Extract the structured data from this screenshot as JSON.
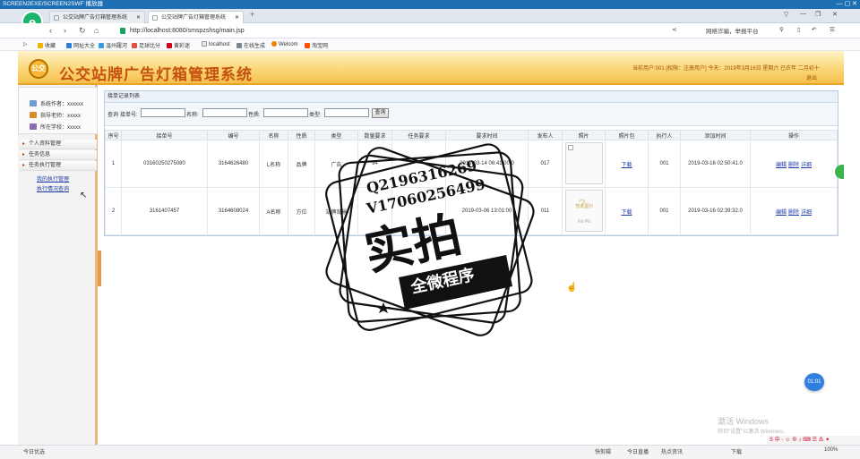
{
  "window": {
    "title": "SCREEN2EXE/SCREEN2SWF 播放器",
    "controls": "— ▢ ✕"
  },
  "tabs": [
    {
      "label": "公交站牌广告灯箱管理系统",
      "active": false
    },
    {
      "label": "公交站牌广告灯箱管理系统",
      "active": true
    }
  ],
  "newtab": "+",
  "address": {
    "url": "http://localhost:8080/smspzshsg/main.jsp",
    "right_text": "网络诈骗，举报平台"
  },
  "bookmarks": [
    "收藏",
    "网址大全",
    "温州履河",
    "足球比分",
    "黄彩迷",
    "localhost",
    "在线生成",
    "Welcom",
    "淘宝网"
  ],
  "header": {
    "logo": "公交",
    "title": "公交站牌广告灯箱管理系统",
    "info": "当前用户:001 [权限：注册用户] 今天：2019年3月16日 星期六 已农年 二月初十",
    "exit": "退出"
  },
  "sidebar": {
    "info": [
      {
        "label": "系统作者：xxxxxx"
      },
      {
        "label": "指导老师：xxxxx"
      },
      {
        "label": "所在学校：xxxxx"
      }
    ],
    "menus": [
      "个人资料管理",
      "任务信息",
      "任务执行管理"
    ],
    "submenus": [
      "我的执行管理",
      "执行情况查询"
    ]
  },
  "panel": {
    "title": "接单记录列表",
    "search": {
      "lead": "查询",
      "fields": [
        "接单号:",
        "名称:",
        "性质:",
        "类型:"
      ],
      "button": "查询"
    },
    "columns": [
      "序号",
      "接单号",
      "编号",
      "名称",
      "性质",
      "类型",
      "数量要求",
      "任务要求",
      "要求时间",
      "发布人",
      "照片",
      "照片包",
      "执行人",
      "添加时间",
      "操作"
    ],
    "rows": [
      {
        "idx": "1",
        "order": "03160250275080",
        "code": "3164626480",
        "name": "L名称",
        "nature": "品牌",
        "type": "广告",
        "qty": "94",
        "req": "",
        "time": "2019-03-14 06:41:00.0",
        "publisher": "017",
        "photo": "",
        "pkg": "下载",
        "executor": "001",
        "added": "2019-03-16 02:50:41.0",
        "ops": [
          "编辑",
          "删除",
          "详细"
        ]
      },
      {
        "idx": "2",
        "order": "3161407457",
        "code": "3164608024",
        "name": "A名称",
        "nature": "方位",
        "type": "站牌背景",
        "qty": "",
        "req": "",
        "time": "2019-03-06 13:01:00",
        "publisher": "011",
        "photo": "暂无图片",
        "photo_sub": "No Pic",
        "pkg": "下载",
        "executor": "001",
        "added": "2019-03-16 02:39:32.0",
        "ops": [
          "编辑",
          "删除",
          "详细"
        ]
      }
    ]
  },
  "watermark": {
    "qq": "Q2196316269",
    "v": "V17060256499",
    "big": "实拍",
    "sub": "全微程序"
  },
  "bubble": "01:01",
  "activate": {
    "line1": "激活 Windows",
    "line2": "转到\"设置\"以激活 Windows。"
  },
  "status": {
    "left": "今日优选",
    "items": [
      "快剪辑",
      "今日直播",
      "热点资讯"
    ],
    "right_items": [
      "下载",
      "100%"
    ]
  },
  "tray": "S 中 ◦ ☺ ⊕ ♪ ⌨ ☰ ♨ ✦"
}
